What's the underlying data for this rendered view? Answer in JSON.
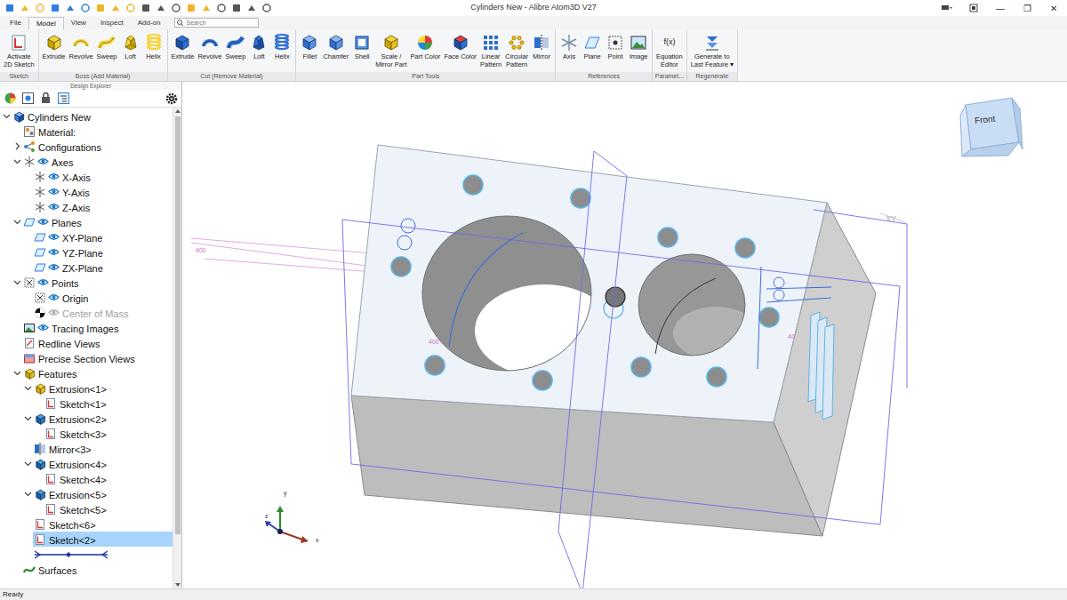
{
  "window": {
    "title": "Cylinders New - Alibre Atom3D V27",
    "controls": [
      "—",
      "❐",
      "✕"
    ]
  },
  "menu_tabs": [
    {
      "label": "File",
      "selected": false
    },
    {
      "label": "Model",
      "selected": true
    },
    {
      "label": "View",
      "selected": false
    },
    {
      "label": "Inspect",
      "selected": false
    },
    {
      "label": "Add-on",
      "selected": false
    }
  ],
  "search": {
    "placeholder": "Search"
  },
  "ribbon": {
    "groups": [
      {
        "label": "Sketch",
        "kind": "sketch",
        "buttons": [
          {
            "lines": [
              "Activate",
              "2D Sketch"
            ]
          }
        ]
      },
      {
        "label": "Boss (Add Material)",
        "kind": "boss",
        "buttons": [
          {
            "lines": [
              "Extrude"
            ]
          },
          {
            "lines": [
              "Revolve"
            ]
          },
          {
            "lines": [
              "Sweep"
            ]
          },
          {
            "lines": [
              "Loft"
            ]
          },
          {
            "lines": [
              "Helix"
            ]
          }
        ]
      },
      {
        "label": "Cut (Remove Material)",
        "kind": "cut",
        "buttons": [
          {
            "lines": [
              "Extrude"
            ]
          },
          {
            "lines": [
              "Revolve"
            ]
          },
          {
            "lines": [
              "Sweep"
            ]
          },
          {
            "lines": [
              "Loft"
            ]
          },
          {
            "lines": [
              "Helix"
            ]
          }
        ]
      },
      {
        "label": "Part Tools",
        "kind": "tools",
        "buttons": [
          {
            "lines": [
              "Fillet"
            ]
          },
          {
            "lines": [
              "Chamfer"
            ]
          },
          {
            "lines": [
              "Shell"
            ]
          },
          {
            "lines": [
              "Scale /",
              "Mirror Part"
            ]
          },
          {
            "lines": [
              "Part Color"
            ]
          },
          {
            "lines": [
              "Face Color"
            ]
          },
          {
            "lines": [
              "Linear",
              "Pattern"
            ]
          },
          {
            "lines": [
              "Circular",
              "Pattern"
            ]
          },
          {
            "lines": [
              "Mirror"
            ]
          }
        ]
      },
      {
        "label": "References",
        "kind": "references",
        "buttons": [
          {
            "lines": [
              "Axis"
            ]
          },
          {
            "lines": [
              "Plane"
            ]
          },
          {
            "lines": [
              "Point"
            ]
          },
          {
            "lines": [
              "Image"
            ]
          }
        ]
      },
      {
        "label": "Paramet...",
        "kind": "parameters",
        "buttons": [
          {
            "lines": [
              "Equation",
              "Editor"
            ],
            "icon_text": "f(x)"
          }
        ]
      },
      {
        "label": "Regenerate",
        "kind": "regenerate",
        "buttons": [
          {
            "lines": [
              "Generate to",
              "Last Feature ▾"
            ]
          }
        ]
      }
    ]
  },
  "explorer": {
    "title": "Design Explorer",
    "tree": [
      {
        "label": "Cylinders New",
        "kind": "part",
        "level": 0,
        "toggle": "open",
        "visibility": "none",
        "selected": false,
        "greyed": false
      },
      {
        "label": "Material:",
        "kind": "material",
        "level": 1,
        "toggle": "none",
        "visibility": "none",
        "selected": false,
        "greyed": false
      },
      {
        "label": "Configurations",
        "kind": "configurations",
        "level": 1,
        "toggle": "closed",
        "visibility": "none",
        "selected": false,
        "greyed": false
      },
      {
        "label": "Axes",
        "kind": "axes",
        "level": 1,
        "toggle": "open",
        "visibility": "shown",
        "selected": false,
        "greyed": false
      },
      {
        "label": "X-Axis",
        "kind": "axis",
        "level": 2,
        "toggle": "none",
        "visibility": "shown",
        "selected": false,
        "greyed": false
      },
      {
        "label": "Y-Axis",
        "kind": "axis",
        "level": 2,
        "toggle": "none",
        "visibility": "shown",
        "selected": false,
        "greyed": false
      },
      {
        "label": "Z-Axis",
        "kind": "axis",
        "level": 2,
        "toggle": "none",
        "visibility": "shown",
        "selected": false,
        "greyed": false
      },
      {
        "label": "Planes",
        "kind": "planes",
        "level": 1,
        "toggle": "open",
        "visibility": "shown",
        "selected": false,
        "greyed": false
      },
      {
        "label": "XY-Plane",
        "kind": "plane",
        "level": 2,
        "toggle": "none",
        "visibility": "shown",
        "selected": false,
        "greyed": false
      },
      {
        "label": "YZ-Plane",
        "kind": "plane",
        "level": 2,
        "toggle": "none",
        "visibility": "shown",
        "selected": false,
        "greyed": false
      },
      {
        "label": "ZX-Plane",
        "kind": "plane",
        "level": 2,
        "toggle": "none",
        "visibility": "shown",
        "selected": false,
        "greyed": false
      },
      {
        "label": "Points",
        "kind": "points",
        "level": 1,
        "toggle": "open",
        "visibility": "shown",
        "selected": false,
        "greyed": false
      },
      {
        "label": "Origin",
        "kind": "point",
        "level": 2,
        "toggle": "none",
        "visibility": "shown",
        "selected": false,
        "greyed": false
      },
      {
        "label": "Center of Mass",
        "kind": "com",
        "level": 2,
        "toggle": "none",
        "visibility": "hidden",
        "selected": false,
        "greyed": true
      },
      {
        "label": "Tracing Images",
        "kind": "tracing",
        "level": 1,
        "toggle": "none",
        "visibility": "shown",
        "selected": false,
        "greyed": false
      },
      {
        "label": "Redline Views",
        "kind": "redline",
        "level": 1,
        "toggle": "none",
        "visibility": "none",
        "selected": false,
        "greyed": false
      },
      {
        "label": "Precise Section Views",
        "kind": "section",
        "level": 1,
        "toggle": "none",
        "visibility": "none",
        "selected": false,
        "greyed": false
      },
      {
        "label": "Features",
        "kind": "features",
        "level": 1,
        "toggle": "open",
        "visibility": "none",
        "selected": false,
        "greyed": false
      },
      {
        "label": "Extrusion<1>",
        "kind": "extrude-add",
        "level": 2,
        "toggle": "open",
        "visibility": "none",
        "selected": false,
        "greyed": false
      },
      {
        "label": "Sketch<1>",
        "kind": "sketch",
        "level": 3,
        "toggle": "none",
        "visibility": "none",
        "selected": false,
        "greyed": false
      },
      {
        "label": "Extrusion<2>",
        "kind": "extrude-cut",
        "level": 2,
        "toggle": "open",
        "visibility": "none",
        "selected": false,
        "greyed": false
      },
      {
        "label": "Sketch<3>",
        "kind": "sketch",
        "level": 3,
        "toggle": "none",
        "visibility": "none",
        "selected": false,
        "greyed": false
      },
      {
        "label": "Mirror<3>",
        "kind": "mirror",
        "level": 2,
        "toggle": "none",
        "visibility": "none",
        "selected": false,
        "greyed": false
      },
      {
        "label": "Extrusion<4>",
        "kind": "extrude-cut",
        "level": 2,
        "toggle": "open",
        "visibility": "none",
        "selected": false,
        "greyed": false
      },
      {
        "label": "Sketch<4>",
        "kind": "sketch",
        "level": 3,
        "toggle": "none",
        "visibility": "none",
        "selected": false,
        "greyed": false
      },
      {
        "label": "Extrusion<5>",
        "kind": "extrude-cut",
        "level": 2,
        "toggle": "open",
        "visibility": "none",
        "selected": false,
        "greyed": false
      },
      {
        "label": "Sketch<5>",
        "kind": "sketch",
        "level": 3,
        "toggle": "none",
        "visibility": "none",
        "selected": false,
        "greyed": false
      },
      {
        "label": "Sketch<6>",
        "kind": "sketch",
        "level": 2,
        "toggle": "none",
        "visibility": "none",
        "selected": false,
        "greyed": false
      },
      {
        "label": "Sketch<2>",
        "kind": "sketch",
        "level": 2,
        "toggle": "none",
        "visibility": "none",
        "selected": true,
        "greyed": false
      },
      {
        "kind": "rollback",
        "level": 2,
        "selected": false
      },
      {
        "label": "Surfaces",
        "kind": "surfaces",
        "level": 1,
        "toggle": "none",
        "visibility": "none",
        "selected": false,
        "greyed": false
      }
    ]
  },
  "viewport": {
    "view_cube": "Front",
    "dimensions": [
      "400",
      "400",
      "40"
    ],
    "plane_label": "XY",
    "axes": [
      "y",
      "z",
      "x"
    ]
  },
  "status_bar": "Ready"
}
